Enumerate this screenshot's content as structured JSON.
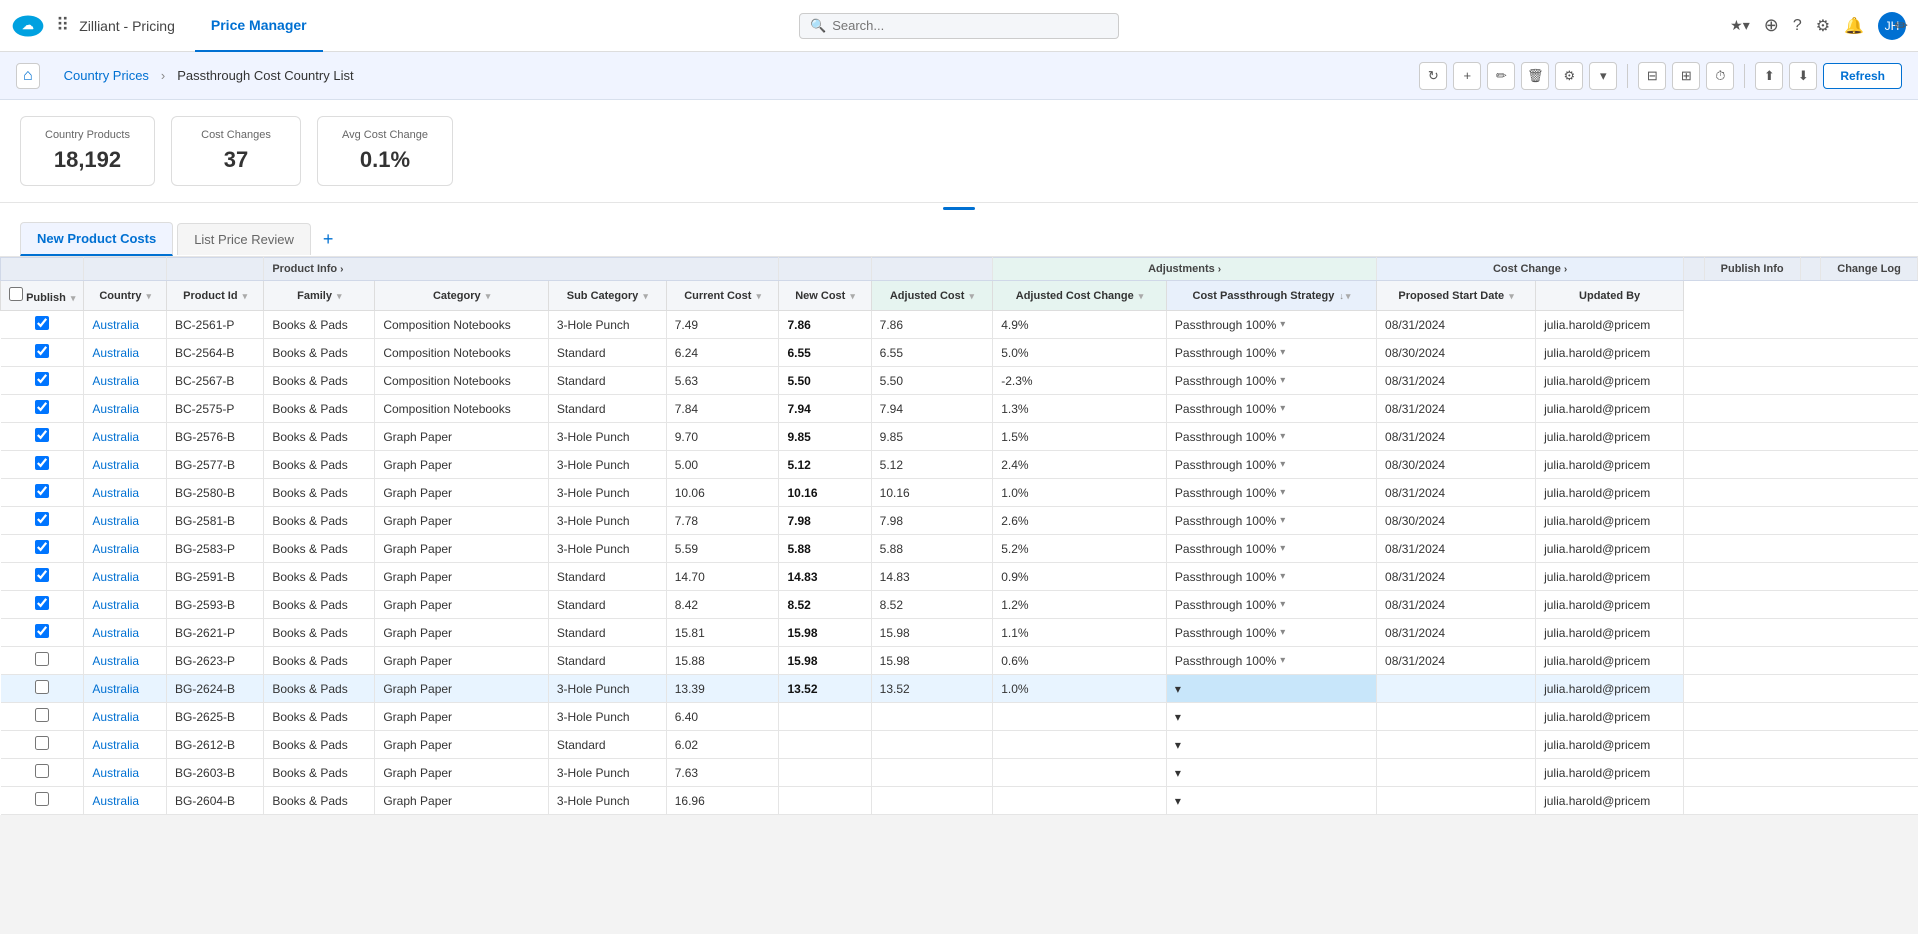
{
  "topNav": {
    "appName": "Zilliant - Pricing",
    "activeTab": "Price Manager",
    "searchPlaceholder": "Search...",
    "icons": [
      "star-icon",
      "plus-icon",
      "question-icon",
      "gear-icon",
      "bell-icon"
    ],
    "avatarInitials": "JH"
  },
  "subHeader": {
    "homeLabel": "⌂",
    "breadcrumb": [
      {
        "label": "Country Prices",
        "link": true
      },
      {
        "label": "Passthrough Cost Country List",
        "link": false
      }
    ],
    "actions": {
      "refresh": "Refresh",
      "icons": [
        "refresh-icon",
        "plus-icon",
        "edit-icon",
        "delete-icon",
        "settings-icon",
        "chevron-icon",
        "filter-icon",
        "columns-icon",
        "clock-icon",
        "upload-icon",
        "download-icon"
      ]
    }
  },
  "summary": {
    "cards": [
      {
        "label": "Country Products",
        "value": "18,192"
      },
      {
        "label": "Cost Changes",
        "value": "37"
      },
      {
        "label": "Avg Cost Change",
        "value": "0.1%"
      }
    ]
  },
  "tabs": [
    {
      "label": "New Product Costs",
      "active": true
    },
    {
      "label": "List Price Review",
      "active": false
    }
  ],
  "addTabLabel": "+",
  "columnGroups": [
    {
      "label": "",
      "colspan": 3
    },
    {
      "label": "Product Info",
      "colspan": 5,
      "hasRightArrow": true
    },
    {
      "label": "",
      "colspan": 2
    },
    {
      "label": "Adjustments",
      "colspan": 2,
      "hasRightArrow": true
    },
    {
      "label": "Cost Change",
      "colspan": 2,
      "hasRightArrow": true
    },
    {
      "label": "",
      "colspan": 1
    },
    {
      "label": "Publish Info",
      "colspan": 2
    },
    {
      "label": "",
      "colspan": 1
    },
    {
      "label": "Change Log",
      "colspan": 1
    }
  ],
  "columns": [
    {
      "label": "Publish",
      "key": "publish",
      "sortable": true
    },
    {
      "label": "Country",
      "key": "country",
      "sortable": true
    },
    {
      "label": "Product Id",
      "key": "productId",
      "sortable": true
    },
    {
      "label": "Family",
      "key": "family",
      "sortable": true
    },
    {
      "label": "Category",
      "key": "category",
      "sortable": true
    },
    {
      "label": "Sub Category",
      "key": "subCategory",
      "sortable": true
    },
    {
      "label": "Current Cost",
      "key": "currentCost",
      "sortable": true
    },
    {
      "label": "New Cost",
      "key": "newCost",
      "sortable": true
    },
    {
      "label": "Adjusted Cost",
      "key": "adjustedCost",
      "sortable": true
    },
    {
      "label": "Adjusted Cost Change",
      "key": "adjustedCostChange",
      "sortable": true
    },
    {
      "label": "Cost Passthrough Strategy",
      "key": "strategy",
      "sortable": true,
      "sortDir": "desc"
    },
    {
      "label": "Proposed Start Date",
      "key": "proposedStartDate",
      "sortable": true
    },
    {
      "label": "Updated By",
      "key": "updatedBy",
      "sortable": false
    }
  ],
  "rows": [
    {
      "checked": true,
      "country": "Australia",
      "productId": "BC-2561-P",
      "family": "Books & Pads",
      "category": "Composition Notebooks",
      "subCategory": "3-Hole Punch",
      "currentCost": "7.49",
      "newCost": "7.86",
      "adjustedCost": "7.86",
      "adjustedCostChange": "4.9%",
      "strategy": "Passthrough 100%",
      "proposedStartDate": "08/31/2024",
      "updatedBy": "julia.harold@pricem",
      "highlighted": false
    },
    {
      "checked": true,
      "country": "Australia",
      "productId": "BC-2564-B",
      "family": "Books & Pads",
      "category": "Composition Notebooks",
      "subCategory": "Standard",
      "currentCost": "6.24",
      "newCost": "6.55",
      "adjustedCost": "6.55",
      "adjustedCostChange": "5.0%",
      "strategy": "Passthrough 100%",
      "proposedStartDate": "08/30/2024",
      "updatedBy": "julia.harold@pricem",
      "highlighted": false
    },
    {
      "checked": true,
      "country": "Australia",
      "productId": "BC-2567-B",
      "family": "Books & Pads",
      "category": "Composition Notebooks",
      "subCategory": "Standard",
      "currentCost": "5.63",
      "newCost": "5.50",
      "adjustedCost": "5.50",
      "adjustedCostChange": "-2.3%",
      "strategy": "Passthrough 100%",
      "proposedStartDate": "08/31/2024",
      "updatedBy": "julia.harold@pricem",
      "highlighted": false
    },
    {
      "checked": true,
      "country": "Australia",
      "productId": "BC-2575-P",
      "family": "Books & Pads",
      "category": "Composition Notebooks",
      "subCategory": "Standard",
      "currentCost": "7.84",
      "newCost": "7.94",
      "adjustedCost": "7.94",
      "adjustedCostChange": "1.3%",
      "strategy": "Passthrough 100%",
      "proposedStartDate": "08/31/2024",
      "updatedBy": "julia.harold@pricem",
      "highlighted": false
    },
    {
      "checked": true,
      "country": "Australia",
      "productId": "BG-2576-B",
      "family": "Books & Pads",
      "category": "Graph Paper",
      "subCategory": "3-Hole Punch",
      "currentCost": "9.70",
      "newCost": "9.85",
      "adjustedCost": "9.85",
      "adjustedCostChange": "1.5%",
      "strategy": "Passthrough 100%",
      "proposedStartDate": "08/31/2024",
      "updatedBy": "julia.harold@pricem",
      "highlighted": false
    },
    {
      "checked": true,
      "country": "Australia",
      "productId": "BG-2577-B",
      "family": "Books & Pads",
      "category": "Graph Paper",
      "subCategory": "3-Hole Punch",
      "currentCost": "5.00",
      "newCost": "5.12",
      "adjustedCost": "5.12",
      "adjustedCostChange": "2.4%",
      "strategy": "Passthrough 100%",
      "proposedStartDate": "08/30/2024",
      "updatedBy": "julia.harold@pricem",
      "highlighted": false
    },
    {
      "checked": true,
      "country": "Australia",
      "productId": "BG-2580-B",
      "family": "Books & Pads",
      "category": "Graph Paper",
      "subCategory": "3-Hole Punch",
      "currentCost": "10.06",
      "newCost": "10.16",
      "adjustedCost": "10.16",
      "adjustedCostChange": "1.0%",
      "strategy": "Passthrough 100%",
      "proposedStartDate": "08/31/2024",
      "updatedBy": "julia.harold@pricem",
      "highlighted": false
    },
    {
      "checked": true,
      "country": "Australia",
      "productId": "BG-2581-B",
      "family": "Books & Pads",
      "category": "Graph Paper",
      "subCategory": "3-Hole Punch",
      "currentCost": "7.78",
      "newCost": "7.98",
      "adjustedCost": "7.98",
      "adjustedCostChange": "2.6%",
      "strategy": "Passthrough 100%",
      "proposedStartDate": "08/30/2024",
      "updatedBy": "julia.harold@pricem",
      "highlighted": false
    },
    {
      "checked": true,
      "country": "Australia",
      "productId": "BG-2583-P",
      "family": "Books & Pads",
      "category": "Graph Paper",
      "subCategory": "3-Hole Punch",
      "currentCost": "5.59",
      "newCost": "5.88",
      "adjustedCost": "5.88",
      "adjustedCostChange": "5.2%",
      "strategy": "Passthrough 100%",
      "proposedStartDate": "08/31/2024",
      "updatedBy": "julia.harold@pricem",
      "highlighted": false
    },
    {
      "checked": true,
      "country": "Australia",
      "productId": "BG-2591-B",
      "family": "Books & Pads",
      "category": "Graph Paper",
      "subCategory": "Standard",
      "currentCost": "14.70",
      "newCost": "14.83",
      "adjustedCost": "14.83",
      "adjustedCostChange": "0.9%",
      "strategy": "Passthrough 100%",
      "proposedStartDate": "08/31/2024",
      "updatedBy": "julia.harold@pricem",
      "highlighted": false
    },
    {
      "checked": true,
      "country": "Australia",
      "productId": "BG-2593-B",
      "family": "Books & Pads",
      "category": "Graph Paper",
      "subCategory": "Standard",
      "currentCost": "8.42",
      "newCost": "8.52",
      "adjustedCost": "8.52",
      "adjustedCostChange": "1.2%",
      "strategy": "Passthrough 100%",
      "proposedStartDate": "08/31/2024",
      "updatedBy": "julia.harold@pricem",
      "highlighted": false
    },
    {
      "checked": true,
      "country": "Australia",
      "productId": "BG-2621-P",
      "family": "Books & Pads",
      "category": "Graph Paper",
      "subCategory": "Standard",
      "currentCost": "15.81",
      "newCost": "15.98",
      "adjustedCost": "15.98",
      "adjustedCostChange": "1.1%",
      "strategy": "Passthrough 100%",
      "proposedStartDate": "08/31/2024",
      "updatedBy": "julia.harold@pricem",
      "highlighted": false
    },
    {
      "checked": false,
      "country": "Australia",
      "productId": "BG-2623-P",
      "family": "Books & Pads",
      "category": "Graph Paper",
      "subCategory": "Standard",
      "currentCost": "15.88",
      "newCost": "15.98",
      "adjustedCost": "15.98",
      "adjustedCostChange": "0.6%",
      "strategy": "Passthrough 100%",
      "proposedStartDate": "08/31/2024",
      "updatedBy": "julia.harold@pricem",
      "highlighted": false
    },
    {
      "checked": false,
      "country": "Australia",
      "productId": "BG-2624-B",
      "family": "Books & Pads",
      "category": "Graph Paper",
      "subCategory": "3-Hole Punch",
      "currentCost": "13.39",
      "newCost": "13.52",
      "adjustedCost": "13.52",
      "adjustedCostChange": "1.0%",
      "strategy": "",
      "proposedStartDate": "",
      "updatedBy": "julia.harold@pricem",
      "highlighted": true
    },
    {
      "checked": false,
      "country": "Australia",
      "productId": "BG-2625-B",
      "family": "Books & Pads",
      "category": "Graph Paper",
      "subCategory": "3-Hole Punch",
      "currentCost": "6.40",
      "newCost": "",
      "adjustedCost": "",
      "adjustedCostChange": "",
      "strategy": "",
      "proposedStartDate": "",
      "updatedBy": "julia.harold@pricem",
      "highlighted": false
    },
    {
      "checked": false,
      "country": "Australia",
      "productId": "BG-2612-B",
      "family": "Books & Pads",
      "category": "Graph Paper",
      "subCategory": "Standard",
      "currentCost": "6.02",
      "newCost": "",
      "adjustedCost": "",
      "adjustedCostChange": "",
      "strategy": "",
      "proposedStartDate": "",
      "updatedBy": "julia.harold@pricem",
      "highlighted": false
    },
    {
      "checked": false,
      "country": "Australia",
      "productId": "BG-2603-B",
      "family": "Books & Pads",
      "category": "Graph Paper",
      "subCategory": "3-Hole Punch",
      "currentCost": "7.63",
      "newCost": "",
      "adjustedCost": "",
      "adjustedCostChange": "",
      "strategy": "",
      "proposedStartDate": "",
      "updatedBy": "julia.harold@pricem",
      "highlighted": false
    },
    {
      "checked": false,
      "country": "Australia",
      "productId": "BG-2604-B",
      "family": "Books & Pads",
      "category": "Graph Paper",
      "subCategory": "3-Hole Punch",
      "currentCost": "16.96",
      "newCost": "",
      "adjustedCost": "",
      "adjustedCostChange": "",
      "strategy": "",
      "proposedStartDate": "",
      "updatedBy": "julia.harold@pricem",
      "highlighted": false
    }
  ]
}
